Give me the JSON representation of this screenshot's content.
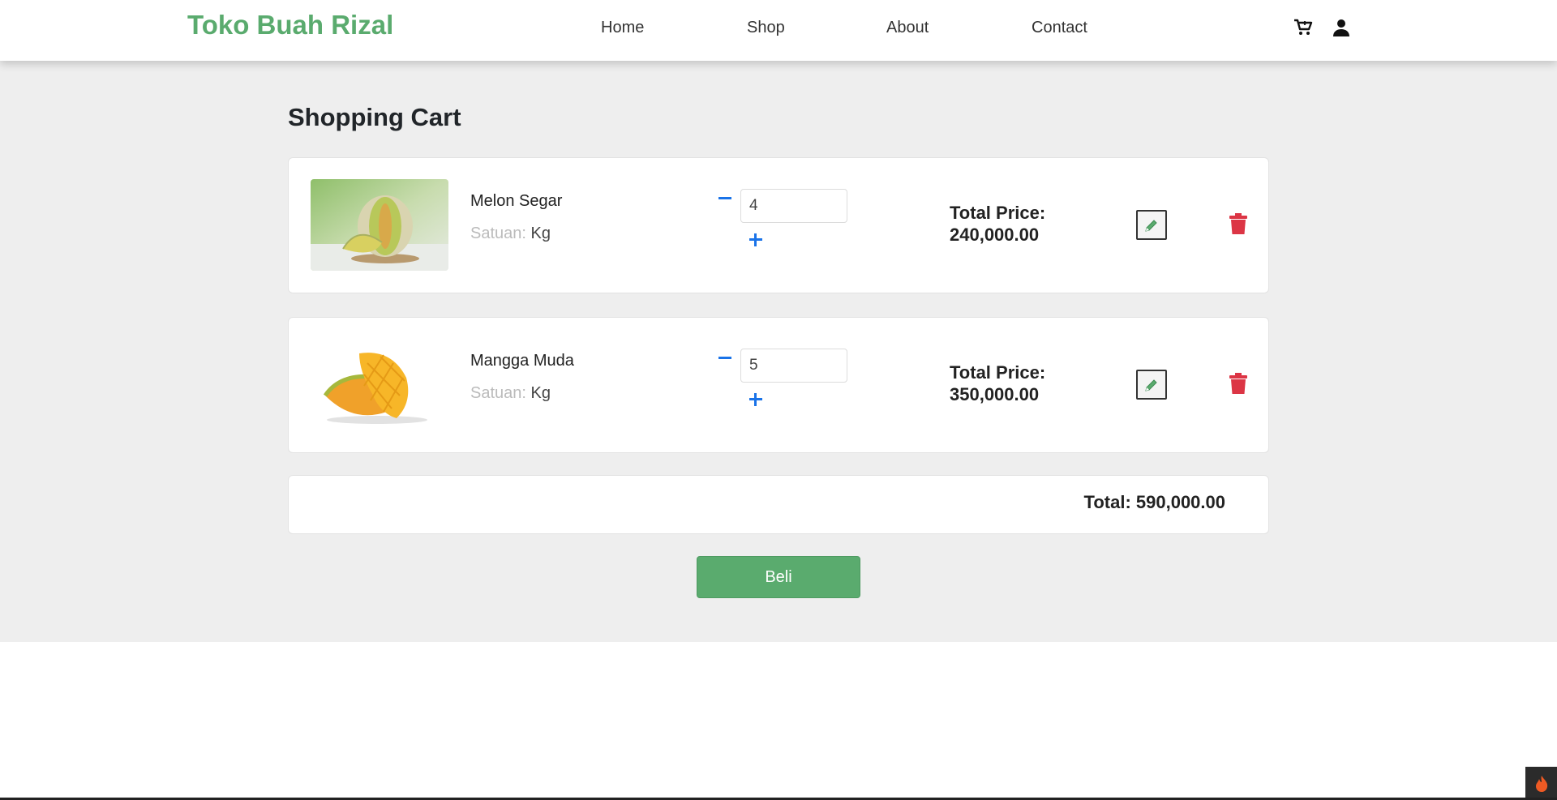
{
  "header": {
    "brand": "Toko Buah Rizal",
    "nav": [
      {
        "label": "Home"
      },
      {
        "label": "Shop"
      },
      {
        "label": "About"
      },
      {
        "label": "Contact"
      }
    ],
    "icons": [
      "cart-icon",
      "user-icon"
    ]
  },
  "cart": {
    "title": "Shopping Cart",
    "items": [
      {
        "name": "Melon Segar",
        "unit_label": "Satuan:",
        "unit_value": "Kg",
        "quantity": "4",
        "total_label": "Total Price:",
        "total_value": "240,000.00",
        "image": "melon-image"
      },
      {
        "name": "Mangga Muda",
        "unit_label": "Satuan:",
        "unit_value": "Kg",
        "quantity": "5",
        "total_label": "Total Price:",
        "total_value": "350,000.00",
        "image": "mango-image"
      }
    ],
    "grand_total": "Total: 590,000.00",
    "buy_label": "Beli"
  },
  "colors": {
    "brand": "#5aab6e",
    "accent_blue": "#1a73e8",
    "danger": "#dc3545",
    "background": "#eeeeee"
  }
}
